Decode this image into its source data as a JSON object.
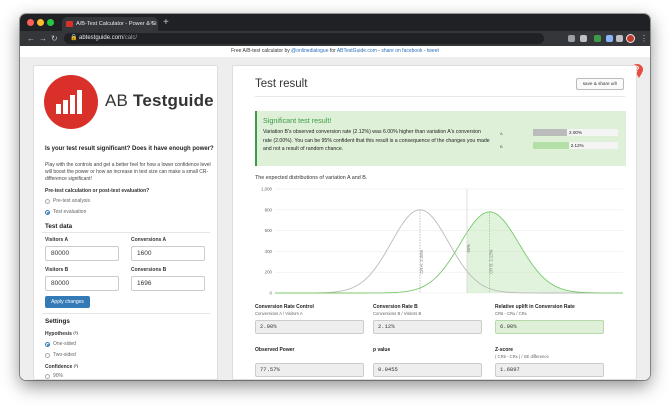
{
  "browser": {
    "tab_title": "A/B-Test Calculator - Power & Si",
    "url_host": "abtestguide.com",
    "url_path": "/calc/"
  },
  "banner": {
    "prefix": "Free A/B-test calculator by",
    "handle": "@onlinedialogue",
    "for": "for",
    "site": "ABTestGuide.com",
    "sep": " - ",
    "share_fb": "share on facebook",
    "dash": " - ",
    "tweet": "tweet"
  },
  "help_glyph": "?",
  "logo": {
    "brand_light": "AB ",
    "brand_bold": "Testguide"
  },
  "left": {
    "question": "Is your test result significant? Does it have enough power?",
    "desc_1": "Play with the controls and get a better feel for how a lower confidence level will boost the power or how an increase in test size can make a small CR-difference significant!",
    "pre_post_label": "Pre-test calculation or post-test evaluation?",
    "radio_pre": "Pre-test analysis",
    "radio_post": "Test evaluation",
    "test_data_title": "Test data",
    "visitors_a_label": "Visitors A",
    "visitors_a": "80000",
    "conversions_a_label": "Conversions A",
    "conversions_a": "1600",
    "visitors_b_label": "Visitors B",
    "visitors_b": "80000",
    "conversions_b_label": "Conversions B",
    "conversions_b": "1696",
    "apply_label": "Apply changes",
    "settings_title": "Settings",
    "hypothesis_label": "Hypothesis",
    "hypothesis_sup": "(?)",
    "one_sided": "One-sided",
    "two_sided": "Two-sided",
    "confidence_label": "Confidence",
    "confidence_sup": "(?)",
    "conf_90": "90%"
  },
  "right": {
    "title": "Test result",
    "share_label": "save & share url!",
    "alert_title": "Significant test result!",
    "alert_text": "Variation B's observed conversion rate (2.12%) was 6.00% higher than variation A's conversion rate (2.00%). You can be 95% confident that this result is a consequence of the changes you made and not a result of random chance.",
    "bar_a_label": "A",
    "bar_a_value": "2.00%",
    "bar_a_fraction": 0.4,
    "bar_b_label": "B",
    "bar_b_value": "2.12%",
    "bar_b_fraction": 0.42,
    "dist_title": "The expected distributions of variation A and B.",
    "stats": [
      {
        "title": "Conversion Rate Control",
        "sub": "Conversions A / Visitors A",
        "value": "2.00%",
        "green": false
      },
      {
        "title": "Conversion Rate B",
        "sub": "Conversions B / Visitors B",
        "value": "2.12%",
        "green": false
      },
      {
        "title": "Relative uplift in Conversion Rate",
        "sub": "CRʙ - CRᴀ / CRᴀ",
        "value": "6.00%",
        "green": true
      },
      {
        "title": "Observed Power",
        "sub": "",
        "value": "77.57%",
        "green": false
      },
      {
        "title": "p value",
        "sub": "",
        "value": "0.0455",
        "green": false
      },
      {
        "title": "Z-score",
        "sub": "( CRʙ - CRᴀ ) / SE difference",
        "value": "1.6897",
        "green": false
      }
    ]
  },
  "colors": {
    "brand_red": "#d9312a",
    "success_green": "#3c9b45",
    "success_bg": "#dff0d8",
    "curve_a": "#bbbbbb",
    "curve_b": "#78c86b",
    "primary_blue": "#337ab7"
  },
  "chart_data": {
    "type": "area",
    "y_ticks": [
      "1,000",
      "800",
      "600",
      "400",
      "200",
      "0"
    ],
    "ylim": [
      0,
      1000
    ],
    "xlim": [
      0.0175,
      0.0235
    ],
    "grid": true,
    "series": [
      {
        "mean": 0.02,
        "sd": 0.000495,
        "peak": 800,
        "label": "CR A: 2.00%"
      },
      {
        "mean": 0.0212,
        "sd": 0.000509,
        "peak": 780,
        "label": "CR B: 2.12%"
      }
    ],
    "threshold": {
      "x": 0.02081,
      "label": "95%"
    }
  }
}
